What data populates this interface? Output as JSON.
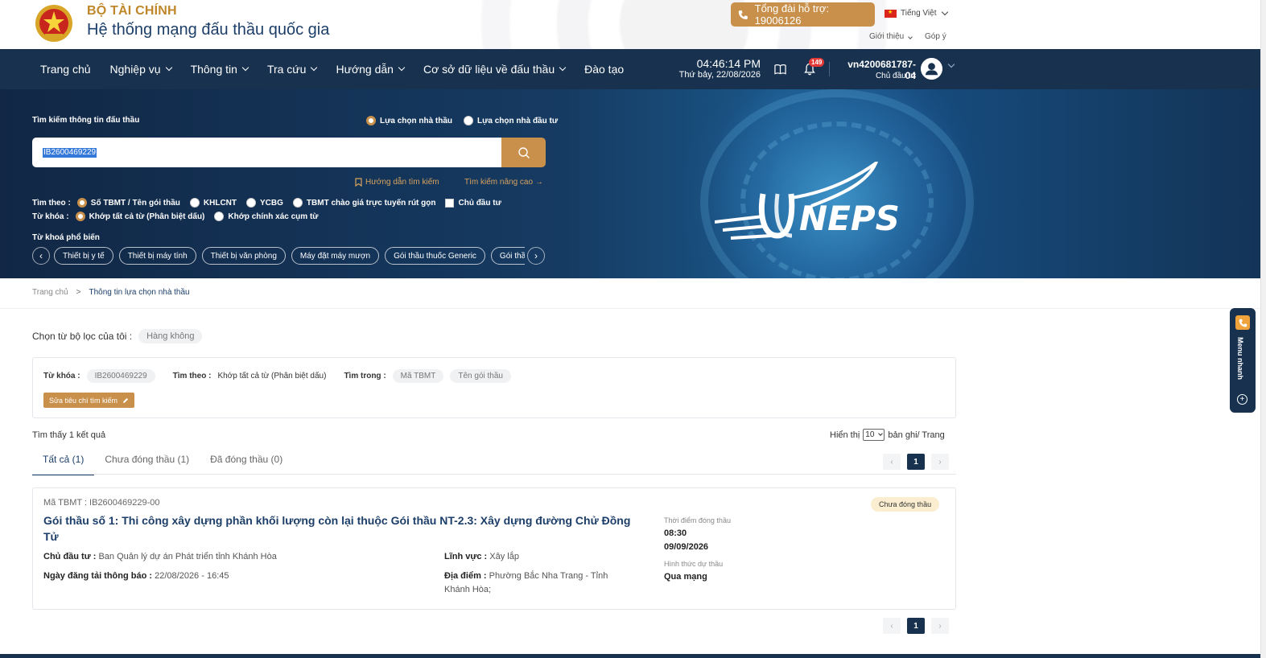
{
  "header": {
    "org": "BỘ TÀI CHÍNH",
    "system_name": "Hệ thống mạng đấu thầu quốc gia",
    "hotline": "Tổng đài hỗ trợ: 19006126",
    "language": "Tiếng Việt",
    "links": [
      "Giới thiệu",
      "Góp ý"
    ]
  },
  "nav": {
    "items": [
      {
        "label": "Trang chủ",
        "dropdown": false
      },
      {
        "label": "Nghiệp vụ",
        "dropdown": true
      },
      {
        "label": "Thông tin",
        "dropdown": true
      },
      {
        "label": "Tra cứu",
        "dropdown": true
      },
      {
        "label": "Hướng dẫn",
        "dropdown": true
      },
      {
        "label": "Cơ sở dữ liệu về đấu thầu",
        "dropdown": true
      },
      {
        "label": "Đào tạo",
        "dropdown": false
      }
    ],
    "time": "04:46:14 PM",
    "date": "Thứ bảy, 22/08/2026",
    "notification_count": "149",
    "user_id": "vn4200681787-04",
    "user_role": "Chủ đầu tư"
  },
  "search": {
    "title": "Tìm kiếm thông tin đấu thầu",
    "mode_options": [
      {
        "label": "Lựa chọn nhà thầu",
        "selected": true
      },
      {
        "label": "Lựa chọn nhà đầu tư",
        "selected": false
      }
    ],
    "value": "IB2600469229",
    "guide_link": "Hướng dẫn tìm kiếm",
    "advanced_link": "Tìm kiếm nâng cao",
    "search_by_label": "Tìm theo :",
    "search_by_options": [
      {
        "label": "Số TBMT / Tên gói thầu",
        "selected": true
      },
      {
        "label": "KHLCNT",
        "selected": false
      },
      {
        "label": "YCBG",
        "selected": false
      },
      {
        "label": "TBMT chào giá trực tuyến rút gọn",
        "selected": false
      }
    ],
    "owner_checkbox": "Chủ đầu tư",
    "keyword_label": "Từ khóa :",
    "keyword_options": [
      {
        "label": "Khớp tất cả từ (Phân biệt dấu)",
        "selected": true
      },
      {
        "label": "Khớp chính xác cụm từ",
        "selected": false
      }
    ],
    "popular_title": "Từ khoá phổ biến",
    "popular_keywords": [
      "Thiết bị y tế",
      "Thiết bị máy tính",
      "Thiết bị văn phòng",
      "Máy đặt máy mượn",
      "Gói thầu thuốc Generic",
      "Gói thầu d"
    ]
  },
  "breadcrumb": {
    "home": "Trang chủ",
    "current": "Thông tin lựa chọn nhà thầu"
  },
  "saved_filter": {
    "label": "Chọn từ bộ lọc của tôi :",
    "value": "Hàng không"
  },
  "criteria": {
    "keyword_label": "Từ khóa :",
    "keyword_value": "IB2600469229",
    "search_by_label": "Tìm theo :",
    "search_by_value": "Khớp tất cả từ (Phân biệt dấu)",
    "search_in_label": "Tìm trong :",
    "search_in_values": [
      "Mã TBMT",
      "Tên gói thầu"
    ],
    "edit_button": "Sửa tiêu chí tìm kiếm"
  },
  "results": {
    "count_text": "Tìm thấy 1 kết quả",
    "per_page_label": "Hiển thị",
    "per_page_value": "10",
    "per_page_suffix": "bản ghi/ Trang",
    "tabs": [
      {
        "label": "Tất cả (1)",
        "active": true
      },
      {
        "label": "Chưa đóng thầu (1)",
        "active": false
      },
      {
        "label": "Đã đóng thầu (0)",
        "active": false
      }
    ],
    "current_page": "1",
    "items": [
      {
        "code": "Mã TBMT : IB2600469229-00",
        "title": "Gói thầu số 1: Thi công xây dựng phần khối lượng còn lại thuộc Gói thầu NT-2.3: Xây dựng đường Chử Đồng Tử",
        "owner_label": "Chủ đầu tư :",
        "owner": "Ban Quản lý dự án Phát triển tỉnh Khánh Hòa",
        "posted_label": "Ngày đăng tải thông báo :",
        "posted": "22/08/2026 - 16:45",
        "field_label": "Lĩnh vực :",
        "field": "Xây lắp",
        "location_label": "Địa điểm :",
        "location": "Phường Bắc Nha Trang - Tỉnh Khánh Hòa;",
        "close_time_label": "Thời điểm đóng thầu",
        "close_time": "08:30",
        "close_date": "09/09/2026",
        "form_label": "Hình thức dự thầu",
        "form": "Qua mạng",
        "status": "Chưa đóng thầu"
      }
    ]
  },
  "quick_menu": {
    "label": "Menu nhanh"
  },
  "colors": {
    "navy": "#17314f",
    "gold": "#c8904a",
    "title_blue": "#1c3e68"
  }
}
